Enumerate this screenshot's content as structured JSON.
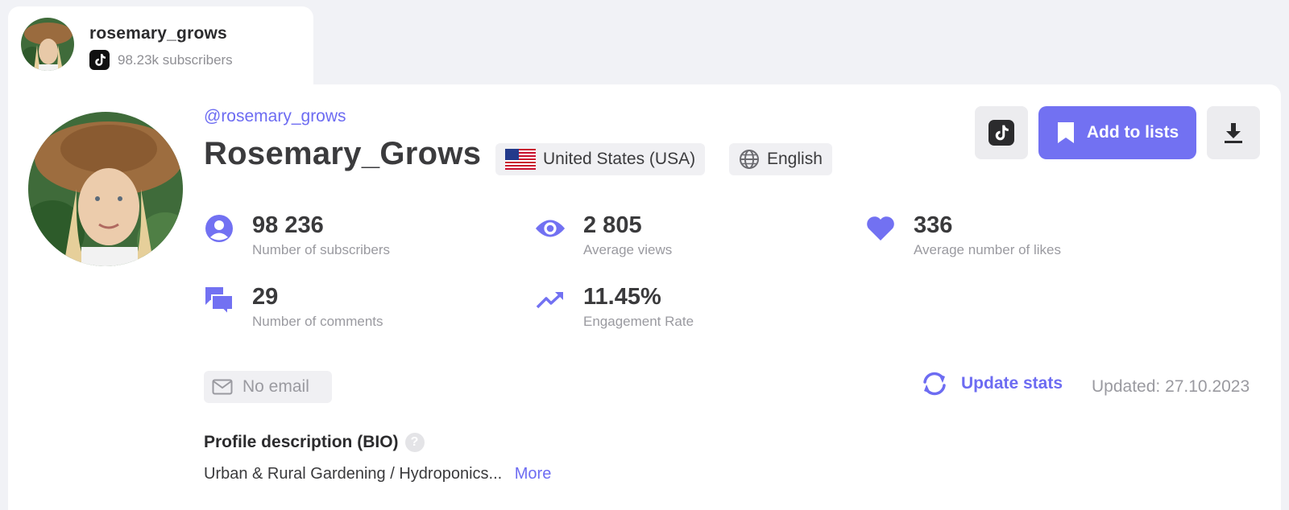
{
  "tab": {
    "name": "rosemary_grows",
    "subscribers": "98.23k subscribers"
  },
  "profile": {
    "handle": "@rosemary_grows",
    "display_name": "Rosemary_Grows",
    "country": "United States (USA)",
    "language": "English"
  },
  "actions": {
    "add_to_lists": "Add to lists"
  },
  "stats": {
    "subscribers": {
      "value": "98 236",
      "label": "Number of subscribers"
    },
    "views": {
      "value": "2 805",
      "label": "Average views"
    },
    "likes": {
      "value": "336",
      "label": "Average number of likes"
    },
    "comments": {
      "value": "29",
      "label": "Number of comments"
    },
    "engagement": {
      "value": "11.45%",
      "label": "Engagement Rate"
    }
  },
  "contact": {
    "email": "No email"
  },
  "update": {
    "label": "Update stats",
    "updated": "Updated: 27.10.2023"
  },
  "bio": {
    "title": "Profile description (BIO)",
    "help": "?",
    "text": "Urban & Rural Gardening / Hydroponics...",
    "more": "More"
  },
  "colors": {
    "accent": "#7271f2",
    "accent_text": "#6d6cf2",
    "muted": "#9a9aa0",
    "chip_bg": "#f0f0f3"
  }
}
